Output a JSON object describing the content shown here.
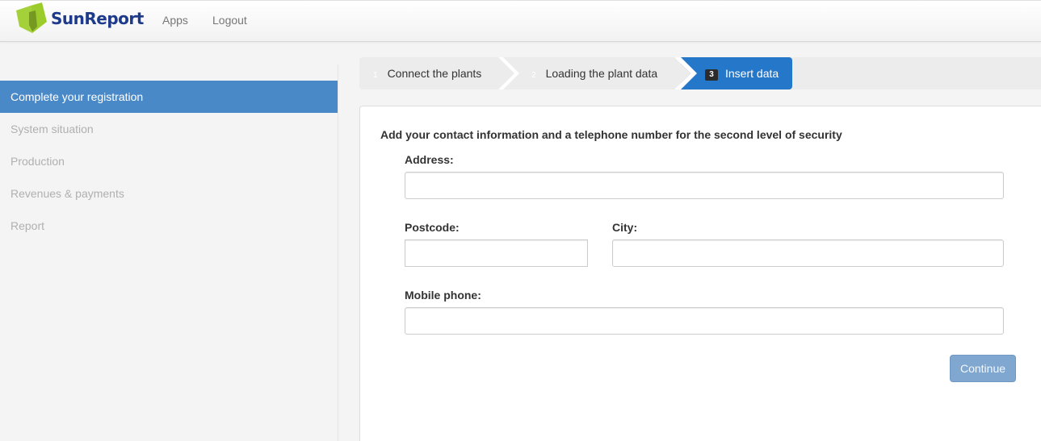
{
  "header": {
    "brand": "SunReport",
    "nav": [
      {
        "label": "Apps"
      },
      {
        "label": "Logout"
      }
    ]
  },
  "sidebar": {
    "items": [
      {
        "label": "Complete your registration",
        "active": true
      },
      {
        "label": "System situation",
        "active": false
      },
      {
        "label": "Production",
        "active": false
      },
      {
        "label": "Revenues & payments",
        "active": false
      },
      {
        "label": "Report",
        "active": false
      }
    ]
  },
  "wizard": {
    "steps": [
      {
        "number": "1",
        "label": "Connect the plants",
        "state": "done"
      },
      {
        "number": "2",
        "label": "Loading the plant data",
        "state": "done"
      },
      {
        "number": "3",
        "label": "Insert data",
        "state": "active"
      }
    ]
  },
  "form": {
    "intro": "Add your contact information and a telephone number for the second level of security",
    "address": {
      "label": "Address:",
      "value": "",
      "placeholder": ""
    },
    "postcode": {
      "label": "Postcode:",
      "value": "",
      "placeholder": ""
    },
    "city": {
      "label": "City:",
      "value": "",
      "placeholder": ""
    },
    "mobile": {
      "label": "Mobile phone:",
      "value": "",
      "placeholder": ""
    },
    "submit_label": "Continue"
  },
  "colors": {
    "brand_blue": "#1e3a8a",
    "brand_green": "#9ccc2c",
    "active_blue": "#2577c9",
    "sidebar_active": "#4a89c8",
    "button_disabled": "#7fa7d0"
  }
}
